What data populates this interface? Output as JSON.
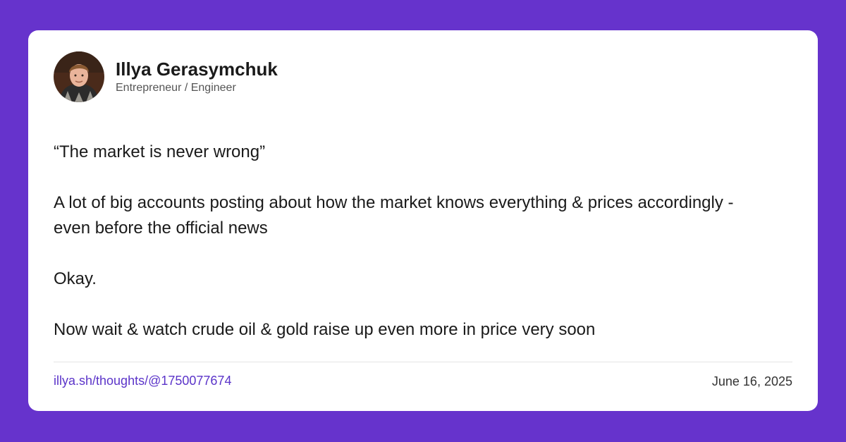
{
  "author": {
    "name": "Illya Gerasymchuk",
    "title": "Entrepreneur / Engineer",
    "avatar_icon": "profile-photo"
  },
  "post": {
    "paragraphs": [
      "“The market is never wrong”",
      "A lot of big accounts posting about how the market knows everything & prices accordingly - even before the official news",
      "Okay.",
      "Now wait & watch crude oil & gold raise up even more in price very soon"
    ]
  },
  "footer": {
    "link": "illya.sh/thoughts/@1750077674",
    "date": "June 16, 2025"
  },
  "colors": {
    "background": "#6633cc",
    "card": "#ffffff",
    "link": "#5b34c9"
  }
}
